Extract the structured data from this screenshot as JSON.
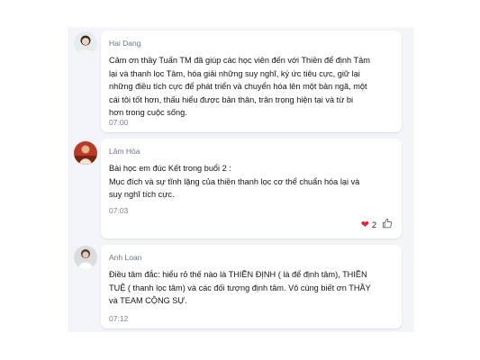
{
  "messages": [
    {
      "sender": "Hai Dang",
      "text": "Cảm ơn thầy Tuấn TM đã giúp các học viên đến với Thiền để định  Tâm\nlại và thanh lọc Tâm, hóa giải những suy nghĩ, ký ức tiêu cực, giữ lại\nnhững điều tích cực để phát triển và chuyển hóa lên một bản ngã, một\ncái tôi tốt hơn, thấu hiểu được bản thân, trân trọng hiện tại và từ bi\nhơn trong cuộc sống.",
      "time": "07:00"
    },
    {
      "sender": "Lâm Hòa",
      "text": "Bài học em đúc Kết trong buổi 2 :\nMục đích và sự tĩnh lặng của thiền thanh lọc cơ thể chuẩn hóa lại và\nsuy nghĩ tích cực.",
      "time": "07:03",
      "reaction_count": "2"
    },
    {
      "sender": "Anh Loan",
      "text": "Điều tâm đắc: hiểu rỏ thế nào là THIỀN ĐỊNH ( là để định tâm), THIỀN\nTUỆ ( thanh lọc tâm) và các đối tượng định tâm. Vô cùng biết ơn THẦY\nvà TEAM CỘNG SỰ.",
      "time": "07:12"
    }
  ],
  "colors": {
    "panel_bg": "#f3f5f8",
    "bubble_bg": "#ffffff",
    "heart": "#e0243c"
  },
  "icons": [
    "heart-icon",
    "thumbs-up-icon"
  ]
}
